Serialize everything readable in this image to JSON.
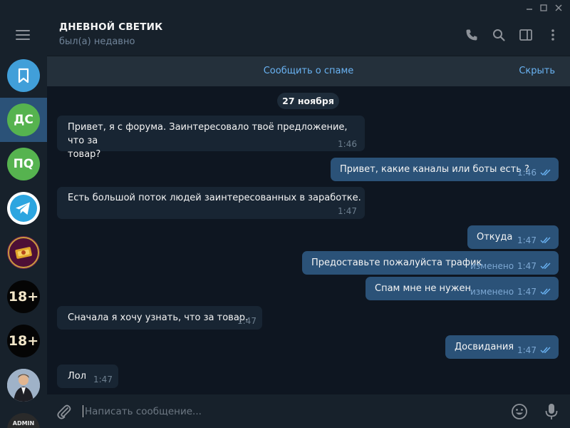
{
  "window": {
    "controls": [
      "minimize-icon",
      "maximize-icon",
      "close-icon"
    ]
  },
  "sidebar": {
    "chats": [
      {
        "name": "saved-messages",
        "icon": "bookmark-icon",
        "color": "#419fd9"
      },
      {
        "name": "dnevnoy-svetik",
        "initials": "ДС",
        "color": "#56b34f",
        "active": true
      },
      {
        "name": "pq",
        "initials": "ПQ",
        "color": "#56b34f"
      },
      {
        "name": "telegram",
        "icon": "telegram-icon",
        "color": "#2ca5e0"
      },
      {
        "name": "cash-channel",
        "icon": "cash-logo",
        "color": "#6a1d4d"
      },
      {
        "name": "18plus-1",
        "text": "18+",
        "color": "#050505"
      },
      {
        "name": "18plus-2",
        "text": "18+",
        "color": "#050505"
      },
      {
        "name": "photo-chat",
        "icon": "person-photo",
        "color": "#5b7fa8"
      },
      {
        "name": "admin-chat",
        "text": "ADMIN",
        "color": "#2a2a2a"
      }
    ]
  },
  "header": {
    "title": "ДНЕВНОЙ СВЕТИК",
    "status": "был(а) недавно",
    "icons": [
      "phone-icon",
      "search-icon",
      "sidebar-toggle-icon",
      "more-icon"
    ]
  },
  "spam_bar": {
    "report": "Сообщить о спаме",
    "hide": "Скрыть"
  },
  "date": "27 ноября",
  "messages": [
    {
      "dir": "in",
      "lines": [
        "Привет, я с форума. Заинтересовало твоё предложение, что за",
        "товар?"
      ],
      "time": "1:46"
    },
    {
      "dir": "out",
      "text": "Привет, какие каналы или боты есть ?",
      "time": "1:46",
      "read": true
    },
    {
      "dir": "in",
      "text": "Есть большой поток людей заинтересованных в заработке.",
      "time": "1:47"
    },
    {
      "dir": "out",
      "text": "Откуда",
      "time": "1:47",
      "read": true
    },
    {
      "dir": "out",
      "text": "Предоставьте пожалуйста трафик",
      "edited": "изменено",
      "time": "1:47",
      "read": true
    },
    {
      "dir": "out",
      "text": "Спам мне не нужен",
      "edited": "изменено",
      "time": "1:47",
      "read": true
    },
    {
      "dir": "in",
      "text": "Сначала я хочу узнать, что за товар.",
      "time": "1:47"
    },
    {
      "dir": "out",
      "text": "Досвидания",
      "time": "1:47",
      "read": true
    },
    {
      "dir": "in",
      "text": "Лол",
      "time": "1:47"
    }
  ],
  "composer": {
    "placeholder": "Написать сообщение...",
    "icons": [
      "attach-icon",
      "emoji-icon",
      "microphone-icon"
    ]
  },
  "colors": {
    "background": "#0e1621",
    "panel": "#17212b",
    "incoming": "#182533",
    "outgoing": "#2b5278",
    "accent": "#6ab3f3"
  }
}
